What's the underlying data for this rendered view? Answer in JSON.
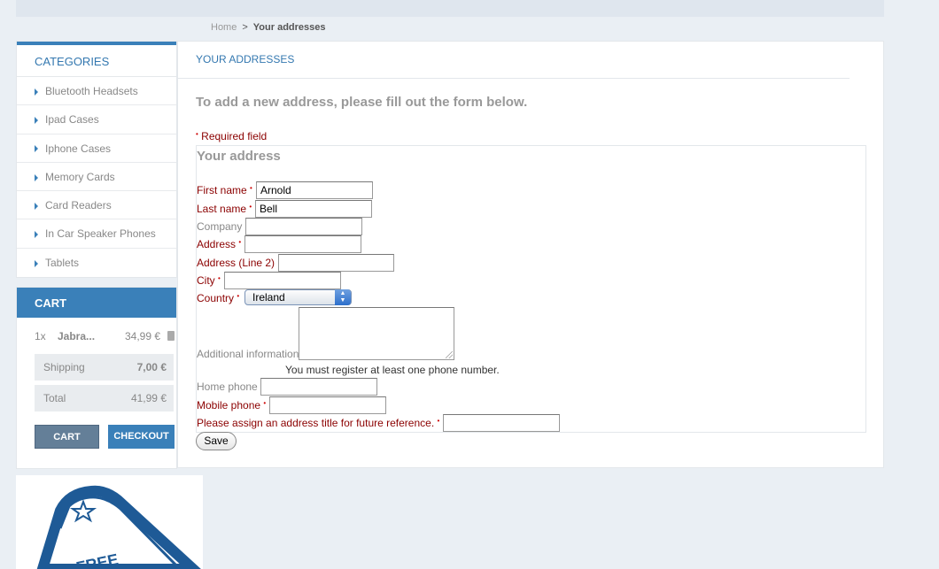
{
  "breadcrumb": {
    "home": "Home",
    "separator": ">",
    "current": "Your addresses"
  },
  "categories": {
    "title": "CATEGORIES",
    "items": [
      {
        "label": "Bluetooth Headsets"
      },
      {
        "label": "Ipad Cases"
      },
      {
        "label": "Iphone Cases"
      },
      {
        "label": "Memory Cards"
      },
      {
        "label": "Card Readers"
      },
      {
        "label": "In Car Speaker Phones"
      },
      {
        "label": "Tablets"
      }
    ]
  },
  "cart": {
    "title": "CART",
    "item": {
      "qty": "1x",
      "name": "Jabra...",
      "price": "34,99 €",
      "remove_icon": "trash-icon"
    },
    "shipping_label": "Shipping",
    "shipping_value": "7,00 €",
    "total_label": "Total",
    "total_value": "41,99 €",
    "cart_button": "CART",
    "checkout_button": "CHECKOUT"
  },
  "badge": {
    "text": "FREE"
  },
  "main": {
    "title": "YOUR ADDRESSES",
    "subtitle": "To add a new address, please fill out the form below.",
    "required_note": "Required field",
    "required_mark": "•",
    "fieldset_title": "Your address"
  },
  "form": {
    "first_name": {
      "label": "First name",
      "value": "Arnold"
    },
    "last_name": {
      "label": "Last name",
      "value": "Bell"
    },
    "company": {
      "label": "Company",
      "value": ""
    },
    "address": {
      "label": "Address",
      "value": ""
    },
    "address2": {
      "label": "Address (Line 2)",
      "value": ""
    },
    "city": {
      "label": "City",
      "value": ""
    },
    "country": {
      "label": "Country",
      "value": "Ireland"
    },
    "additional": {
      "label": "Additional information",
      "value": ""
    },
    "phone_note": "You must register at least one phone number.",
    "home_phone": {
      "label": "Home phone",
      "value": ""
    },
    "mobile_phone": {
      "label": "Mobile phone",
      "value": ""
    },
    "alias": {
      "label": "Please assign an address title for future reference.",
      "value": ""
    },
    "save_label": "Save"
  },
  "colors": {
    "accent": "#3a80b9",
    "required": "#8b0000",
    "background": "#eaeff4"
  }
}
